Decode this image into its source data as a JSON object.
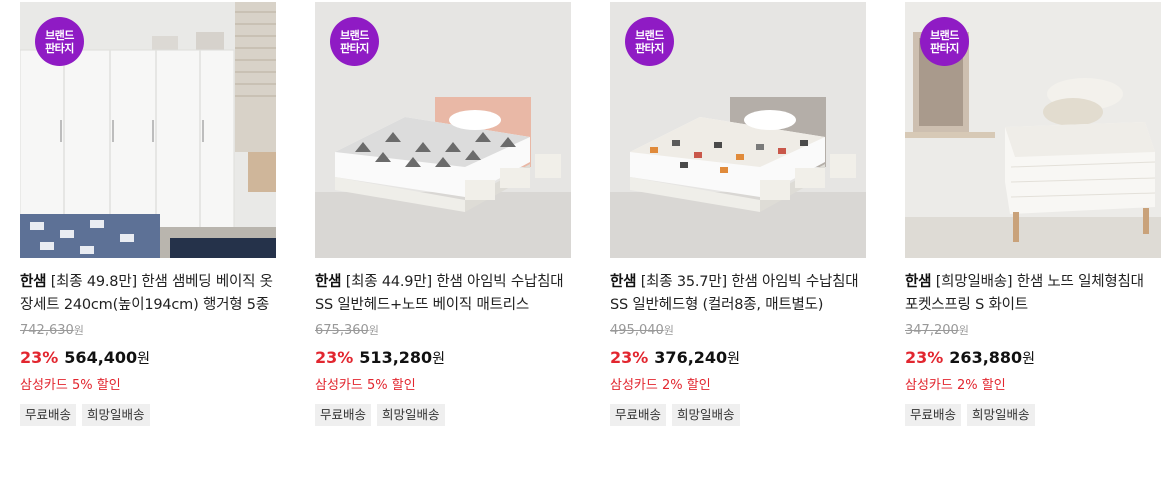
{
  "badge": {
    "line1": "브랜드",
    "line2": "판타지"
  },
  "products": [
    {
      "brand": "한샘",
      "title": "[최종 49.8만] 한샘 샘베딩 베이직 옷장세트 240cm(높이194cm) 행거형 5종",
      "original_price": "742,630",
      "discount_rate": "23%",
      "price": "564,400",
      "currency": "원",
      "benefit": "삼성카드 5% 할인",
      "tags": [
        "무료배송",
        "희망일배송"
      ]
    },
    {
      "brand": "한샘",
      "title": "[최종 44.9만] 한샘 아임빅 수납침대 SS 일반헤드+노뜨 베이직 매트리스",
      "original_price": "675,360",
      "discount_rate": "23%",
      "price": "513,280",
      "currency": "원",
      "benefit": "삼성카드 5% 할인",
      "tags": [
        "무료배송",
        "희망일배송"
      ]
    },
    {
      "brand": "한샘",
      "title": "[최종 35.7만] 한샘 아임빅 수납침대 SS 일반헤드형 (컬러8종, 매트별도)",
      "original_price": "495,040",
      "discount_rate": "23%",
      "price": "376,240",
      "currency": "원",
      "benefit": "삼성카드 2% 할인",
      "tags": [
        "무료배송",
        "희망일배송"
      ]
    },
    {
      "brand": "한샘",
      "title": "[희망일배송] 한샘 노뜨 일체형침대 포켓스프링 S 화이트",
      "original_price": "347,200",
      "discount_rate": "23%",
      "price": "263,880",
      "currency": "원",
      "benefit": "삼성카드 2% 할인",
      "tags": [
        "무료배송",
        "희망일배송"
      ]
    }
  ]
}
